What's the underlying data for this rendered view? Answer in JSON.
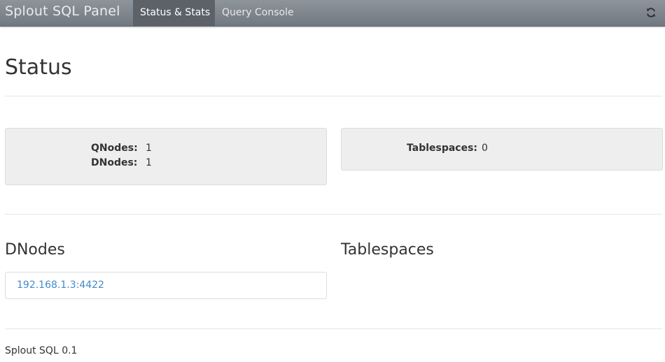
{
  "navbar": {
    "brand": "Splout SQL Panel",
    "tabs": [
      {
        "label": "Status & Stats",
        "active": true
      },
      {
        "label": "Query Console",
        "active": false
      }
    ],
    "refresh_icon": "refresh-icon"
  },
  "page": {
    "title": "Status"
  },
  "stats": {
    "qnodes_label": "QNodes:",
    "qnodes_value": "1",
    "dnodes_label": "DNodes:",
    "dnodes_value": "1",
    "tablespaces_label": "Tablespaces:",
    "tablespaces_value": "0"
  },
  "dnodes_section": {
    "title": "DNodes",
    "items": [
      "192.168.1.3:4422"
    ]
  },
  "tablespaces_section": {
    "title": "Tablespaces",
    "items": []
  },
  "footer": {
    "text": "Splout SQL 0.1"
  },
  "colors": {
    "navbar_bg": "#7f858d",
    "active_tab_bg": "#5d6269",
    "well_bg": "#eeeeee",
    "link": "#428bca"
  }
}
